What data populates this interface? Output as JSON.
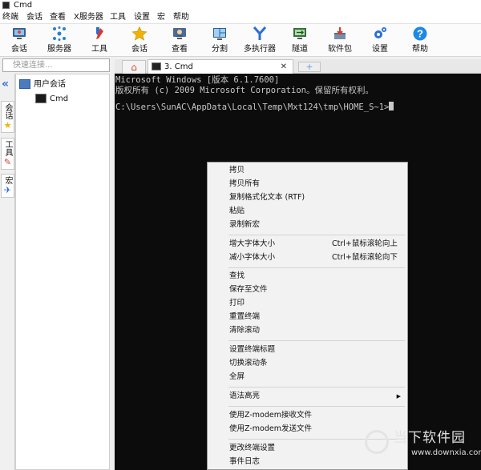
{
  "app": {
    "title": "Cmd"
  },
  "menu": [
    "终端",
    "会话",
    "查看",
    "X服务器",
    "工具",
    "设置",
    "宏",
    "帮助"
  ],
  "toolbar": [
    {
      "label": "会话",
      "icon": "monitor-icon"
    },
    {
      "label": "服务器",
      "icon": "network-icon"
    },
    {
      "label": "工具",
      "icon": "tools-icon"
    },
    {
      "label": "会话",
      "icon": "star-icon"
    },
    {
      "label": "查看",
      "icon": "view-icon"
    },
    {
      "label": "分割",
      "icon": "split-icon"
    },
    {
      "label": "多执行器",
      "icon": "multiexec-icon"
    },
    {
      "label": "隧道",
      "icon": "tunnel-icon"
    },
    {
      "label": "软件包",
      "icon": "package-icon"
    },
    {
      "label": "设置",
      "icon": "settings-icon"
    },
    {
      "label": "帮助",
      "icon": "help-icon"
    }
  ],
  "search": {
    "placeholder": "快速连接..."
  },
  "side_tabs": [
    "会话",
    "工具",
    "宏"
  ],
  "tree": {
    "root": "用户会话",
    "child": "Cmd"
  },
  "tabs": {
    "session_label": "3. Cmd",
    "close": "✕",
    "new": "+"
  },
  "terminal": {
    "lines": [
      "Microsoft Windows [版本 6.1.7600]",
      "版权所有 (c) 2009 Microsoft Corporation。保留所有权利。"
    ],
    "prompt": "C:\\Users\\SunAC\\AppData\\Local\\Temp\\Mxt124\\tmp\\HOME_S~1>"
  },
  "context_menu": [
    {
      "label": "拷贝"
    },
    {
      "label": "拷贝所有"
    },
    {
      "label": "复制格式化文本 (RTF)"
    },
    {
      "label": "粘贴"
    },
    {
      "label": "录制新宏"
    },
    {
      "label": "增大字体大小",
      "shortcut": "Ctrl+鼠标滚轮向上"
    },
    {
      "label": "减小字体大小",
      "shortcut": "Ctrl+鼠标滚轮向下"
    },
    {
      "label": "查找"
    },
    {
      "label": "保存至文件"
    },
    {
      "label": "打印"
    },
    {
      "label": "重置终端"
    },
    {
      "label": "清除滚动"
    },
    {
      "label": "设置终端标题"
    },
    {
      "label": "切换滚动条"
    },
    {
      "label": "全屏"
    },
    {
      "label": "语法高亮",
      "submenu": "▶"
    },
    {
      "label": "使用Z-modem接收文件"
    },
    {
      "label": "使用Z-modem发送文件"
    },
    {
      "label": "更改终端设置"
    },
    {
      "label": "事件日志"
    }
  ],
  "watermark": {
    "text": "当下软件园",
    "url": "www.downxia.com"
  },
  "colors": {
    "accent": "#2a6fd6",
    "terminal_bg": "#0c0c0c",
    "terminal_fg": "#c8c8c8",
    "menu_bg": "#f2f2f2"
  }
}
